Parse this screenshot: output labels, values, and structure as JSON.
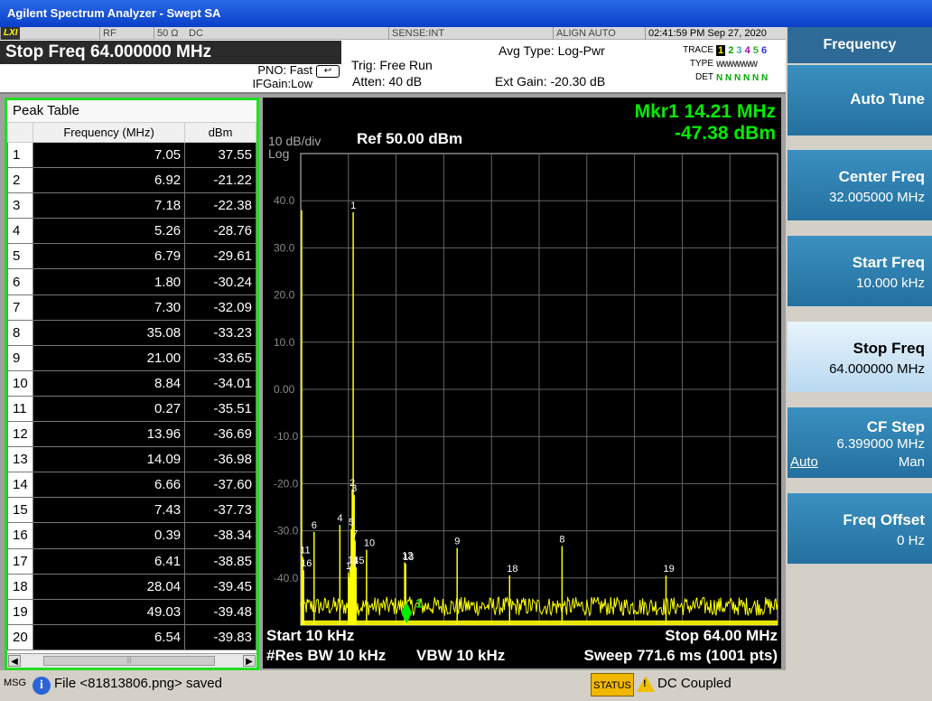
{
  "title": "Agilent Spectrum Analyzer - Swept SA",
  "info": {
    "lxi": "LXI",
    "rf": "RF",
    "impedance": "50 Ω",
    "coupling": "DC",
    "sense": "SENSE:INT",
    "align": "ALIGN AUTO",
    "datetime": "02:41:59 PM Sep 27, 2020",
    "stop_freq": "Stop Freq 64.000000 MHz",
    "pno": "PNO: Fast",
    "ifgain": "IFGain:Low",
    "trig": "Trig: Free Run",
    "atten": "Atten: 40 dB",
    "avg_type": "Avg Type: Log-Pwr",
    "ext_gain": "Ext Gain: -20.30 dB",
    "trace_label": "TRACE",
    "trace_digits": [
      "1",
      "2",
      "3",
      "4",
      "5",
      "6"
    ],
    "type_label": "TYPE",
    "type_value": "WWWWWW",
    "det_label": "DET",
    "det_value": "N N N N N N"
  },
  "peak_table": {
    "title": "Peak Table",
    "col_freq": "Frequency (MHz)",
    "col_dbm": "dBm",
    "rows": [
      {
        "n": "1",
        "f": "7.05",
        "d": "37.55"
      },
      {
        "n": "2",
        "f": "6.92",
        "d": "-21.22"
      },
      {
        "n": "3",
        "f": "7.18",
        "d": "-22.38"
      },
      {
        "n": "4",
        "f": "5.26",
        "d": "-28.76"
      },
      {
        "n": "5",
        "f": "6.79",
        "d": "-29.61"
      },
      {
        "n": "6",
        "f": "1.80",
        "d": "-30.24"
      },
      {
        "n": "7",
        "f": "7.30",
        "d": "-32.09"
      },
      {
        "n": "8",
        "f": "35.08",
        "d": "-33.23"
      },
      {
        "n": "9",
        "f": "21.00",
        "d": "-33.65"
      },
      {
        "n": "10",
        "f": "8.84",
        "d": "-34.01"
      },
      {
        "n": "11",
        "f": "0.27",
        "d": "-35.51"
      },
      {
        "n": "12",
        "f": "13.96",
        "d": "-36.69"
      },
      {
        "n": "13",
        "f": "14.09",
        "d": "-36.98"
      },
      {
        "n": "14",
        "f": "6.66",
        "d": "-37.60"
      },
      {
        "n": "15",
        "f": "7.43",
        "d": "-37.73"
      },
      {
        "n": "16",
        "f": "0.39",
        "d": "-38.34"
      },
      {
        "n": "17",
        "f": "6.41",
        "d": "-38.85"
      },
      {
        "n": "18",
        "f": "28.04",
        "d": "-39.45"
      },
      {
        "n": "19",
        "f": "49.03",
        "d": "-39.48"
      },
      {
        "n": "20",
        "f": "6.54",
        "d": "-39.83"
      }
    ]
  },
  "screen": {
    "marker_freq": "Mkr1 14.21 MHz",
    "marker_amp": "-47.38 dBm",
    "scale": "10 dB/div",
    "ref": "Ref 50.00 dBm",
    "log": "Log",
    "start": "Start 10 kHz",
    "stop": "Stop 64.00 MHz",
    "res_bw": "#Res BW 10 kHz",
    "vbw": "VBW 10 kHz",
    "sweep": "Sweep  771.6 ms (1001 pts)",
    "marker_label": "1",
    "y_ticks": [
      "40.0",
      "30.0",
      "20.0",
      "10.0",
      "0.00",
      "-10.0",
      "-20.0",
      "-30.0",
      "-40.0"
    ]
  },
  "chart_data": {
    "type": "line",
    "title": "",
    "xlabel": "",
    "ylabel": "",
    "xlim": [
      0.01,
      64.0
    ],
    "ylim": [
      -50.0,
      50.0
    ],
    "series": [
      {
        "values": [
          [
            0.27,
            -35.51
          ],
          [
            0.39,
            -38.34
          ],
          [
            1.8,
            -30.24
          ],
          [
            5.26,
            -28.76
          ],
          [
            6.41,
            -38.85
          ],
          [
            6.54,
            -39.83
          ],
          [
            6.66,
            -37.6
          ],
          [
            6.79,
            -29.61
          ],
          [
            6.92,
            -21.22
          ],
          [
            7.05,
            37.55
          ],
          [
            7.18,
            -22.38
          ],
          [
            7.3,
            -32.09
          ],
          [
            7.43,
            -37.73
          ],
          [
            8.84,
            -34.01
          ],
          [
            13.96,
            -36.69
          ],
          [
            14.09,
            -36.98
          ],
          [
            14.21,
            -47.38
          ],
          [
            21.0,
            -33.65
          ],
          [
            28.04,
            -39.45
          ],
          [
            35.08,
            -33.23
          ],
          [
            49.03,
            -39.48
          ]
        ]
      }
    ],
    "peak_labels": [
      {
        "n": "1",
        "x": 7.05,
        "y": 37.55
      },
      {
        "n": "2",
        "x": 6.92,
        "y": -21.22
      },
      {
        "n": "3",
        "x": 7.18,
        "y": -22.38
      },
      {
        "n": "4",
        "x": 5.26,
        "y": -28.76
      },
      {
        "n": "5",
        "x": 6.79,
        "y": -29.61
      },
      {
        "n": "6",
        "x": 1.8,
        "y": -30.24
      },
      {
        "n": "7",
        "x": 7.3,
        "y": -32.09
      },
      {
        "n": "8",
        "x": 35.08,
        "y": -33.23
      },
      {
        "n": "9",
        "x": 21.0,
        "y": -33.65
      },
      {
        "n": "10",
        "x": 8.84,
        "y": -34.01
      },
      {
        "n": "11",
        "x": 0.27,
        "y": -35.51
      },
      {
        "n": "12",
        "x": 13.96,
        "y": -36.69
      },
      {
        "n": "13",
        "x": 14.09,
        "y": -36.98
      },
      {
        "n": "14",
        "x": 6.66,
        "y": -37.6
      },
      {
        "n": "15",
        "x": 7.43,
        "y": -37.73
      },
      {
        "n": "16",
        "x": 0.39,
        "y": -38.34
      },
      {
        "n": "17",
        "x": 6.41,
        "y": -38.85
      },
      {
        "n": "18",
        "x": 28.04,
        "y": -39.45
      },
      {
        "n": "19",
        "x": 49.03,
        "y": -39.48
      }
    ],
    "noise_floor": -47.0,
    "grid": true,
    "trace_color": "#ffff00"
  },
  "softkeys": {
    "menu_title": "Frequency",
    "auto_tune": "Auto Tune",
    "center_freq": "Center Freq",
    "center_freq_val": "32.005000 MHz",
    "start_freq": "Start Freq",
    "start_freq_val": "10.000 kHz",
    "stop_freq": "Stop Freq",
    "stop_freq_val": "64.000000 MHz",
    "cf_step": "CF Step",
    "cf_step_val": "6.399000 MHz",
    "cf_auto": "Auto",
    "cf_man": "Man",
    "freq_offset": "Freq Offset",
    "freq_offset_val": "0 Hz"
  },
  "status": {
    "msg": "MSG",
    "info_icon": "info-icon",
    "file_msg": "File <81813806.png> saved",
    "status_label": "STATUS",
    "dc_coupled": "DC Coupled"
  },
  "colors": {
    "trace": "#ffff00",
    "marker": "#00ee00",
    "softkey": "#2a7cb0",
    "highlight": "#22dd22"
  }
}
